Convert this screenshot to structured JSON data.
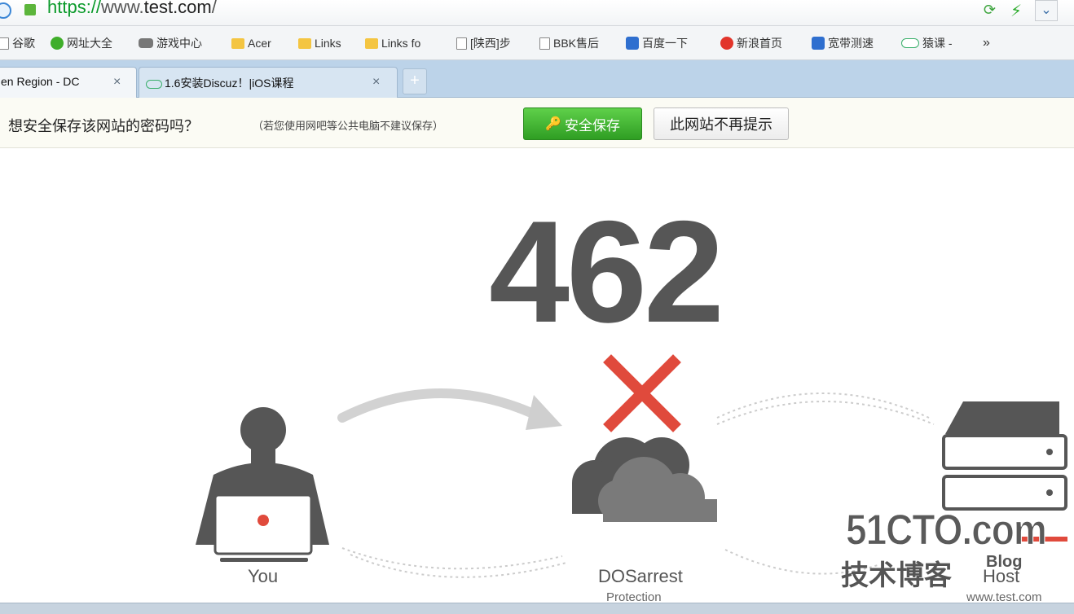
{
  "address_bar": {
    "scheme": "https://",
    "subdomain": "www.",
    "host": "test.com",
    "path": "/",
    "refresh_icon": "refresh-icon",
    "accelerate_icon": "lightning-icon",
    "menu_icon": "chevron-down-icon"
  },
  "bookmarks": [
    {
      "label": "谷歌",
      "icon": "page-icon"
    },
    {
      "label": "网址大全",
      "icon": "globe-icon"
    },
    {
      "label": "游戏中心",
      "icon": "gamepad-icon"
    },
    {
      "label": "Acer",
      "icon": "folder-icon"
    },
    {
      "label": "Links",
      "icon": "folder-icon"
    },
    {
      "label": "Links fo",
      "icon": "folder-icon"
    },
    {
      "label": "[陕西]步",
      "icon": "page-icon"
    },
    {
      "label": "BBK售后",
      "icon": "page-icon"
    },
    {
      "label": "百度一下",
      "icon": "baidu-icon"
    },
    {
      "label": "新浪首页",
      "icon": "weibo-icon"
    },
    {
      "label": "宽带测速",
      "icon": "telecom-icon"
    },
    {
      "label": "猿课 -",
      "icon": "ape-icon"
    }
  ],
  "bookmarks_more": "»",
  "tabs": [
    {
      "label": "en Region - DC",
      "active": true
    },
    {
      "label": "1.6安装Discuz！|iOS课程",
      "active": false
    }
  ],
  "tab_close": "×",
  "new_tab": "+",
  "password_bar": {
    "prompt": "想安全保存该网站的密码吗？",
    "note": "（若您使用网吧等公共电脑不建议保存）",
    "save_label": "安全保存",
    "never_label": "此网站不再提示"
  },
  "page": {
    "counter": "462",
    "labels": {
      "you": "You",
      "protection_line1": "DOSarrest",
      "protection_line2": "Protection",
      "host": "Host",
      "host_domain": "www.test.com"
    },
    "colors": {
      "icon_gray": "#565656",
      "error_red": "#e04a3c",
      "arrow_gray": "#d2d2d2"
    }
  },
  "watermark": {
    "brand": "51CTO.com",
    "subtitle": "技术博客",
    "blog": "Blog"
  }
}
